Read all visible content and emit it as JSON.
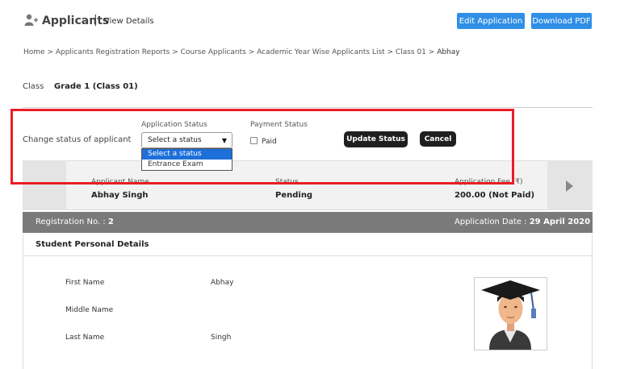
{
  "header": {
    "title": "Applicants",
    "separator": "|",
    "view_details": "View Details",
    "edit_button": "Edit Application",
    "pdf_button": "Download PDF"
  },
  "breadcrumb": {
    "path": "Home > Applicants Registration Reports > Course Applicants > Academic Year Wise Applicants List > Class 01 > ",
    "current": "Abhay"
  },
  "class_info": {
    "label": "Class",
    "value": "Grade 1 (Class 01)"
  },
  "status_form": {
    "change_label": "Change status of applicant",
    "application_status_label": "Application Status",
    "payment_status_label": "Payment Status",
    "selected_value": "Select a status",
    "options": [
      "Select a status",
      "Entrance Exam"
    ],
    "paid_label": "Paid",
    "paid_checked": false,
    "update_button": "Update Status",
    "cancel_button": "Cancel"
  },
  "summary": {
    "headers": {
      "name": "Applicant Name",
      "status": "Status",
      "fee": "Application Fee (₹)"
    },
    "values": {
      "name": "Abhay Singh",
      "status": "Pending",
      "fee": "200.00 (Not Paid)"
    }
  },
  "registration": {
    "reg_label": "Registration No. : ",
    "reg_no": "2",
    "date_label": "Application Date : ",
    "date_value": "29 April 2020"
  },
  "personal": {
    "title": "Student Personal Details",
    "fields": [
      {
        "label": "First Name",
        "value": "Abhay"
      },
      {
        "label": "Middle Name",
        "value": ""
      },
      {
        "label": "Last Name",
        "value": "Singh"
      }
    ]
  },
  "colors": {
    "accent_blue": "#2f8fe6",
    "highlight_red": "#e81e25",
    "dark_button": "#1f1f1f",
    "bar_gray": "#7a7a7a"
  }
}
